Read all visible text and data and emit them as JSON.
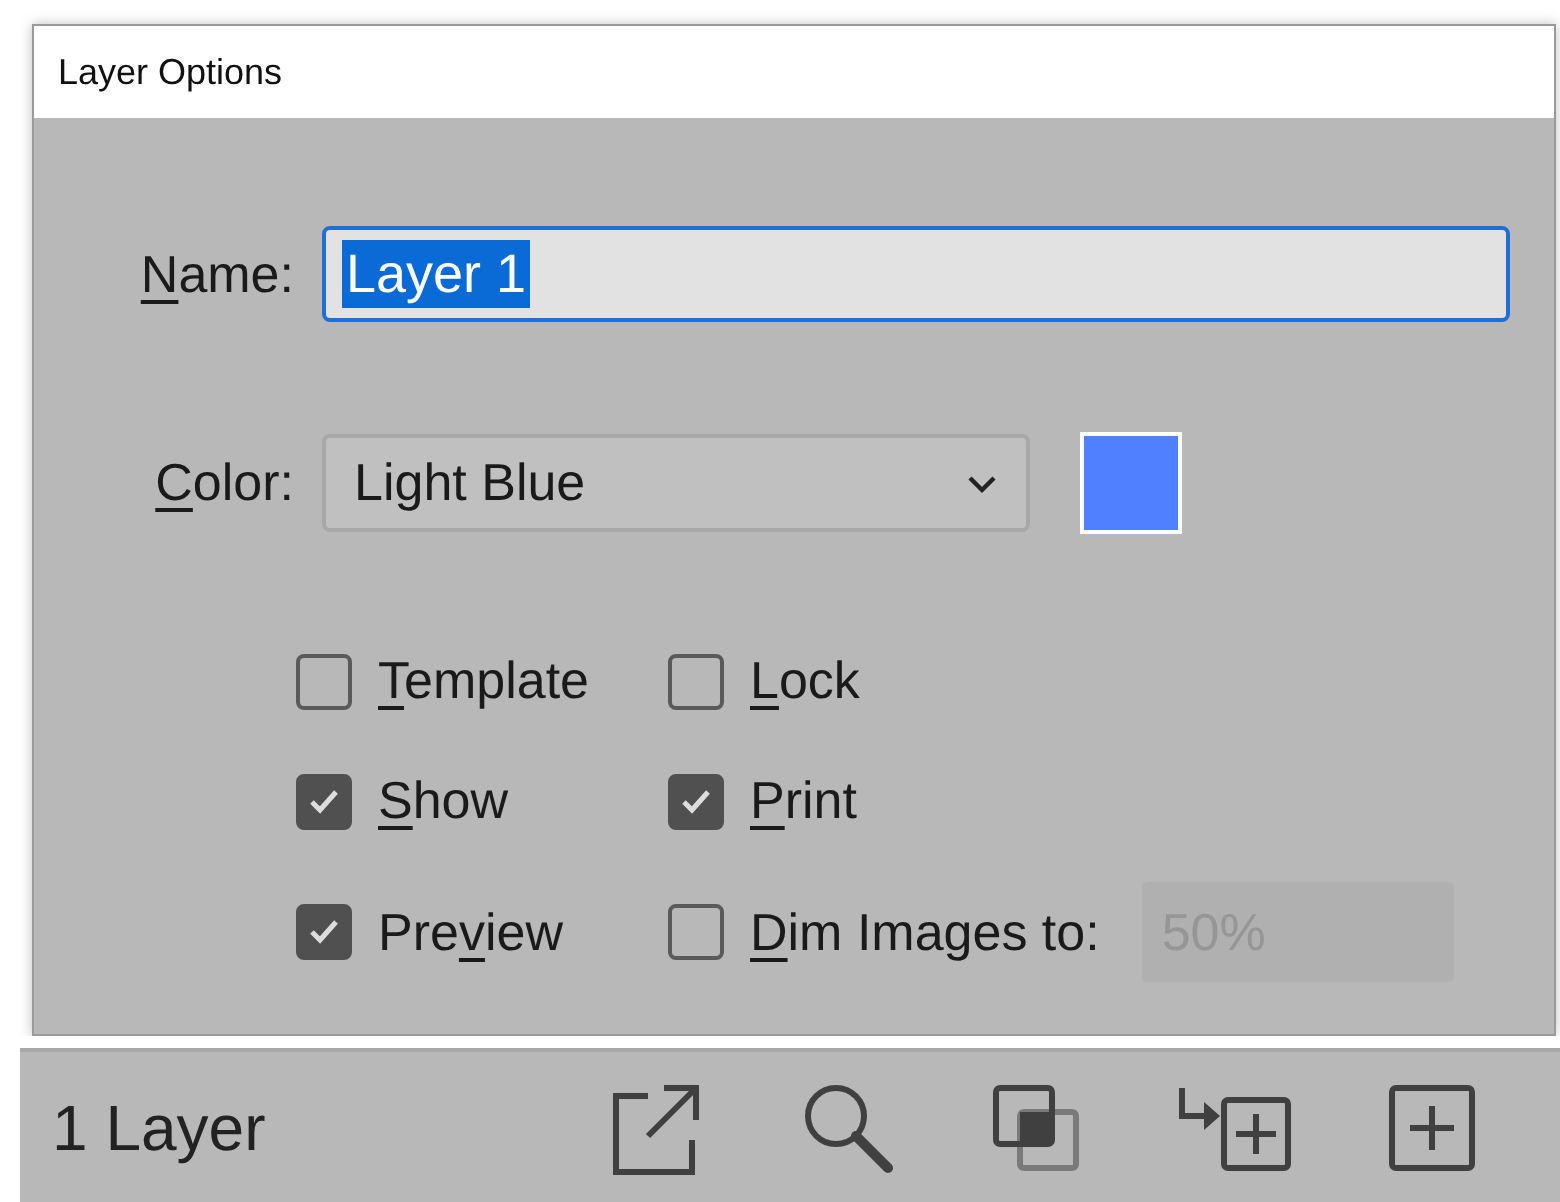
{
  "window": {
    "title": "Layer Options"
  },
  "name_field": {
    "label": {
      "key": "N",
      "after": "ame:"
    },
    "value": "Layer 1",
    "text_selected": true
  },
  "color_field": {
    "label": {
      "key": "C",
      "after": "olor:"
    },
    "value": "Light Blue",
    "swatch": {
      "color": "#5080ff"
    }
  },
  "options": [
    {
      "label": {
        "key": "T",
        "after": "emplate"
      },
      "checked": false
    },
    {
      "label": {
        "key": "L",
        "after": "ock"
      },
      "checked": false
    },
    {
      "label": {
        "key": "S",
        "after": "how"
      },
      "checked": true
    },
    {
      "label": {
        "key": "P",
        "after": "rint"
      },
      "checked": true
    },
    {
      "label": {
        "before": "Pre",
        "key": "v",
        "after": "iew"
      },
      "checked": true
    },
    {
      "label": {
        "key": "D",
        "after": "im Images to:"
      },
      "checked": false,
      "field": {
        "value": "50%",
        "disabled": true
      }
    }
  ],
  "layers_panel": {
    "count": "1 Layer",
    "tools": [
      {
        "kind": "export"
      },
      {
        "kind": "search"
      },
      {
        "kind": "mask"
      },
      {
        "kind": "sublayer"
      },
      {
        "kind": "new"
      }
    ]
  }
}
